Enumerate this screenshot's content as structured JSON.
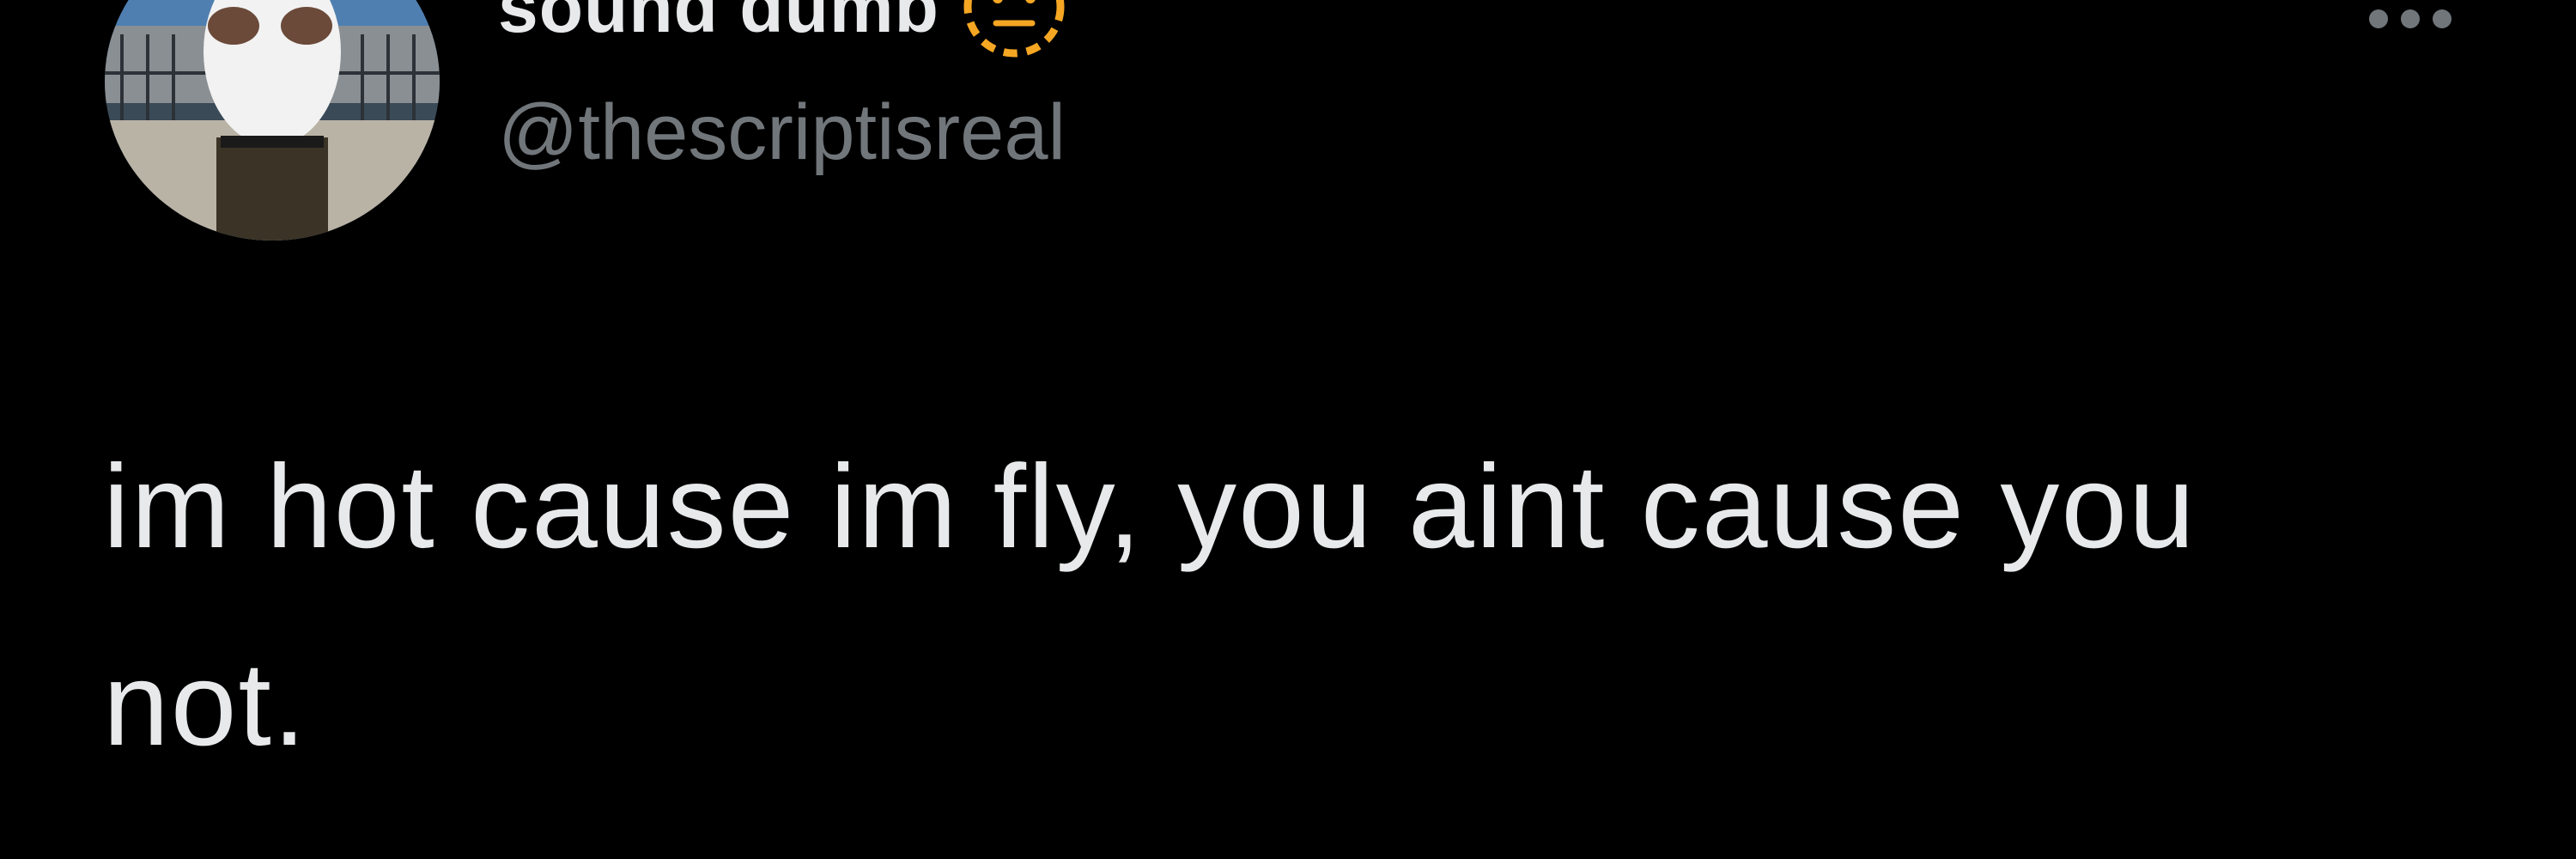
{
  "author": {
    "display_name": "sound dumb",
    "handle": "@thescriptisreal",
    "name_emoji": "dotted-line-face-icon",
    "avatar": "profile-photo"
  },
  "tweet": {
    "text": "im hot cause im fly, you aint cause you not."
  },
  "actions": {
    "more": "more-options-icon"
  },
  "colors": {
    "background": "#000000",
    "text_primary": "#e7e9ea",
    "text_secondary": "#71767b",
    "emoji": "#f5a623"
  }
}
